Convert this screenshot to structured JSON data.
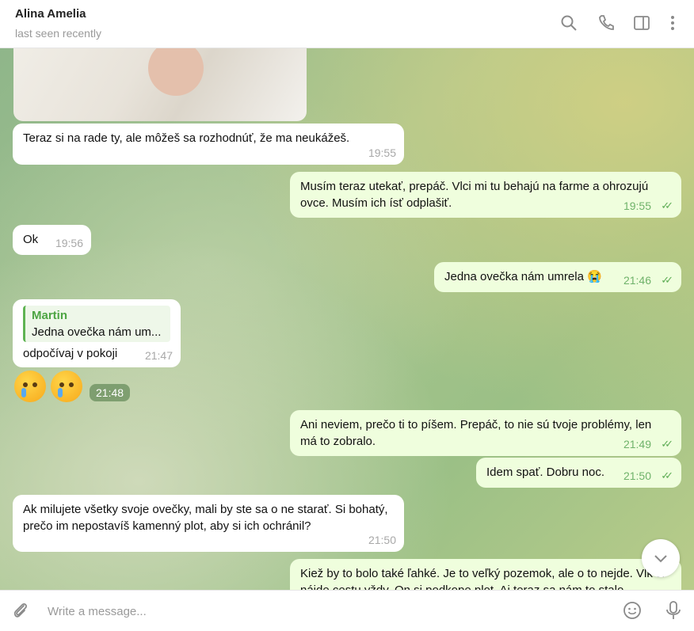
{
  "header": {
    "title": "Alina Amelia",
    "status": "last seen recently",
    "icons": [
      "search-icon",
      "phone-icon",
      "sidebar-icon",
      "more-icon"
    ]
  },
  "messages": [
    {
      "dir": "in",
      "text": "Teraz si na rade ty, ale môžeš sa rozhodnúť, že ma neukážeš.",
      "time": "19:55"
    },
    {
      "dir": "out",
      "text": "Musím teraz utekať, prepáč. Vlci mi tu behajú na farme a ohrozujú ovce. Musím ich ísť odplašiť.",
      "time": "19:55"
    },
    {
      "dir": "in",
      "text": "Ok",
      "time": "19:56"
    },
    {
      "dir": "out",
      "text": "Jedna ovečka nám umrela 😭",
      "time": "21:46"
    },
    {
      "dir": "in",
      "reply_name": "Martin",
      "reply_text": "Jedna ovečka nám um...",
      "text": "odpočívaj v pokoji",
      "time": "21:47"
    },
    {
      "dir": "in",
      "emoji": [
        "crying-face",
        "crying-face"
      ],
      "time": "21:48"
    },
    {
      "dir": "out",
      "text": "Ani neviem, prečo ti to píšem. Prepáč, to nie sú tvoje problémy, len má to zobralo.",
      "time": "21:49"
    },
    {
      "dir": "out",
      "text": "Idem spať. Dobru noc.",
      "time": "21:50"
    },
    {
      "dir": "in",
      "text": "Ak milujete všetky svoje ovečky, mali by ste sa o ne starať. Si bohatý, prečo im nepostavíš kamenný plot, aby si ich ochránil?",
      "time": "21:50"
    },
    {
      "dir": "out",
      "text": "Kiež by to bolo také ľahké. Je to veľký pozemok, ale o to nejde. Vlk si nájde cestu vždy. On si podkope plot. Aj teraz sa nám to stalo",
      "time": ""
    }
  ],
  "composer": {
    "placeholder": "Write a message..."
  },
  "colors": {
    "incoming": "#ffffff",
    "outgoing": "#effedd",
    "check": "#5fae56"
  }
}
